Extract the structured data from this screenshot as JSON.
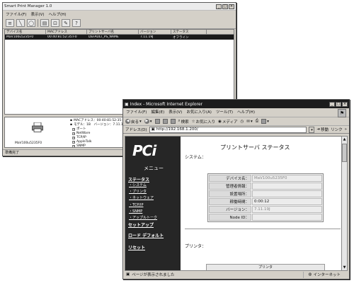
{
  "spm": {
    "title": "Smart Print Manager 1.0",
    "menu": [
      "ファイル(F)",
      "表示(V)",
      "ヘルプ(H)"
    ],
    "columns": [
      "デバイス名",
      "MACアドレス",
      "プリントサーバ名",
      "バージョン",
      "ステータス"
    ],
    "selected_row": [
      "MaV100u5235F0",
      "00:40:81:52:35:F0",
      "DEFAULT_PS_NAME",
      "7.11.19J",
      "オフライン"
    ],
    "printer_name": "MaV100u5235F0",
    "tree": {
      "mac": "MACアドレス：00:40:81:52:35:F0",
      "model": "モデル：1B　バージョン：7.11.19J",
      "port": "ポート",
      "netware": "NetWare",
      "tcpip": "TCP/IP",
      "appletalk": "AppleTalk",
      "snmp": "SNMP"
    },
    "status": "準備完了"
  },
  "ie": {
    "title": "Index - Microsoft Internet Explorer",
    "menu": [
      "ファイル(F)",
      "編集(E)",
      "表示(V)",
      "お気に入り(A)",
      "ツール(T)",
      "ヘルプ(H)"
    ],
    "toolbar": {
      "back": "戻る",
      "search": "検索",
      "favorites": "お気に入り",
      "media": "メディア"
    },
    "address_label": "アドレス(D)",
    "address_value": "http://192.168.1.200/",
    "go": "移動",
    "links": "リンク",
    "status_left": "ページが表示されました",
    "status_zone": "インターネット"
  },
  "page": {
    "logo": "PCi",
    "menu_title": "メニュー",
    "nav_status": "ステータス",
    "nav_status_items": [
      "システム",
      "プリンタ",
      "ネットウェア",
      "TCP/IP",
      "SNMP",
      "アップルトーク"
    ],
    "nav_setup": "セットアップ",
    "nav_default": "ロード デフォルト",
    "nav_reset": "リセット",
    "title": "プリントサーバ ステータス",
    "system_label": "システム：",
    "rows": [
      {
        "label": "デバイス名：",
        "value": "MaV100u5235F0"
      },
      {
        "label": "管理者情報：",
        "value": ""
      },
      {
        "label": "設置場所：",
        "value": ""
      },
      {
        "label": "稼働時間：",
        "value": "0:00:12"
      },
      {
        "label": "バージョン：",
        "value": "7.11.19J"
      },
      {
        "label": "Node ID：",
        "value": ""
      }
    ],
    "printer_label": "プリンタ：",
    "printer_box": "プリンタ"
  }
}
